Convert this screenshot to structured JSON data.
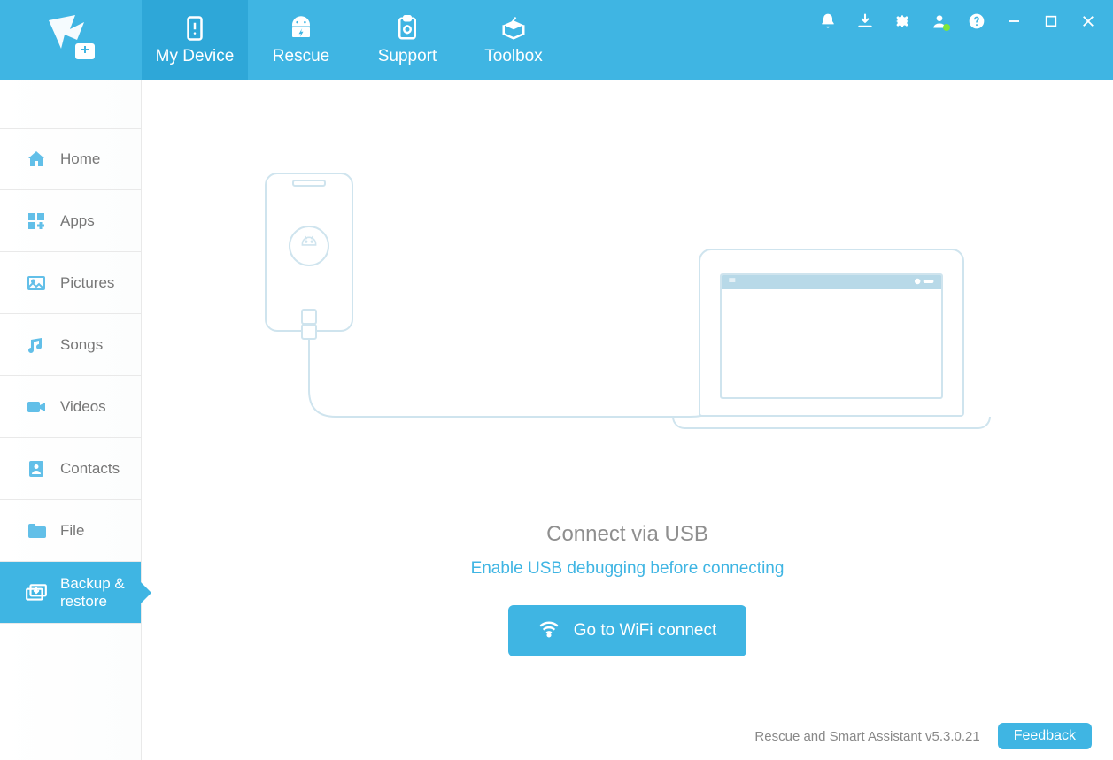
{
  "header": {
    "tabs": [
      {
        "id": "my-device",
        "label": "My Device"
      },
      {
        "id": "rescue",
        "label": "Rescue"
      },
      {
        "id": "support",
        "label": "Support"
      },
      {
        "id": "toolbox",
        "label": "Toolbox"
      }
    ],
    "active_tab": "my-device"
  },
  "window_buttons": {
    "notifications": "bell-icon",
    "download": "download-icon",
    "settings": "gear-icon",
    "account": "user-icon",
    "help": "help-icon",
    "minimize": "minimize-icon",
    "maximize": "maximize-icon",
    "close": "close-icon"
  },
  "sidebar": {
    "items": [
      {
        "id": "home",
        "label": "Home",
        "icon": "home-icon"
      },
      {
        "id": "apps",
        "label": "Apps",
        "icon": "apps-icon"
      },
      {
        "id": "pictures",
        "label": "Pictures",
        "icon": "pictures-icon"
      },
      {
        "id": "songs",
        "label": "Songs",
        "icon": "songs-icon"
      },
      {
        "id": "videos",
        "label": "Videos",
        "icon": "videos-icon"
      },
      {
        "id": "contacts",
        "label": "Contacts",
        "icon": "contacts-icon"
      },
      {
        "id": "file",
        "label": "File",
        "icon": "file-icon"
      },
      {
        "id": "backup",
        "label": "Backup & restore",
        "icon": "backup-icon"
      }
    ],
    "active": "backup"
  },
  "main": {
    "title": "Connect via USB",
    "link": "Enable USB debugging before connecting",
    "wifi_button": "Go to WiFi connect"
  },
  "footer": {
    "version": "Rescue and Smart Assistant v5.3.0.21",
    "feedback": "Feedback"
  }
}
